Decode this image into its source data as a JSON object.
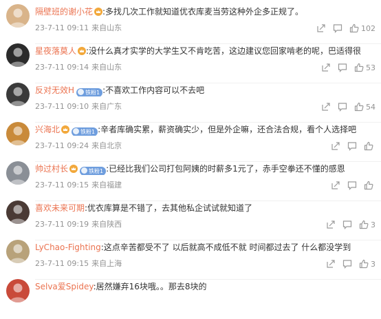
{
  "comments": [
    {
      "username": "隔壁班的谢小花",
      "badge": "",
      "crown": true,
      "text": ":多找几次工作就知道优衣库麦当劳这种外企多正规了。",
      "date": "23-7-11 09:11",
      "location": "来自山东",
      "likes": "102",
      "avatar_color": "#d9b48a"
    },
    {
      "username": "星夜落莫人",
      "badge": "",
      "crown": true,
      "text": ":没什么真才实学的大学生又不肯吃苦，这边建议您回家啃老的呢，巴适得很",
      "date": "23-7-11 09:14",
      "location": "来自山东",
      "likes": "53",
      "avatar_color": "#2b2b2b"
    },
    {
      "username": "反对无效H",
      "badge": "铁粉1",
      "crown": false,
      "text": ":不喜欢工作内容可以不去吧",
      "date": "23-7-11 09:10",
      "location": "来自广东",
      "likes": "54",
      "avatar_color": "#3a3a3a"
    },
    {
      "username": "兴海北",
      "badge": "铁粉1",
      "crown": true,
      "text": ":辛者库确实累，薪资确实少，但是外企嘛，还合法合规，看个人选择吧",
      "date": "23-7-11 09:24",
      "location": "来自北京",
      "likes": "",
      "avatar_color": "#c98a3a"
    },
    {
      "username": "帅过村长",
      "badge": "铁粉1",
      "crown": true,
      "text": ":已经比我们公司打包阿姨的时薪多1元了，赤手空拳还不懂的感恩",
      "date": "23-7-11 09:15",
      "location": "来自福建",
      "likes": "",
      "avatar_color": "#8a8f96"
    },
    {
      "username": "喜欢未来可期",
      "badge": "",
      "crown": false,
      "text": ":优衣库算是不错了，去其他私企试试就知道了",
      "date": "23-7-11 09:19",
      "location": "来自陕西",
      "likes": "3",
      "avatar_color": "#4a3a35"
    },
    {
      "username": "LyChao-Fighting",
      "badge": "",
      "crown": false,
      "text": ":这点辛苦都受不了  以后就高不成低不就  时间都过去了  什么都没学到",
      "date": "23-7-11 09:15",
      "location": "来自上海",
      "likes": "3",
      "avatar_color": "#b8a27a"
    },
    {
      "username": "Selva爱Spidey",
      "badge": "",
      "crown": false,
      "text": ":居然嫌弃16块哦。。那去8块的",
      "date": "",
      "location": "",
      "likes": "",
      "avatar_color": "#c94a3a"
    }
  ],
  "colors": {
    "username": "#eb7350",
    "meta": "#939393",
    "badge_blue": "#6f9ede",
    "crown": "#f2a83b"
  },
  "icons": {
    "share": "share-icon",
    "comment": "comment-icon",
    "like": "thumbs-up-icon",
    "crown": "crown-icon"
  }
}
